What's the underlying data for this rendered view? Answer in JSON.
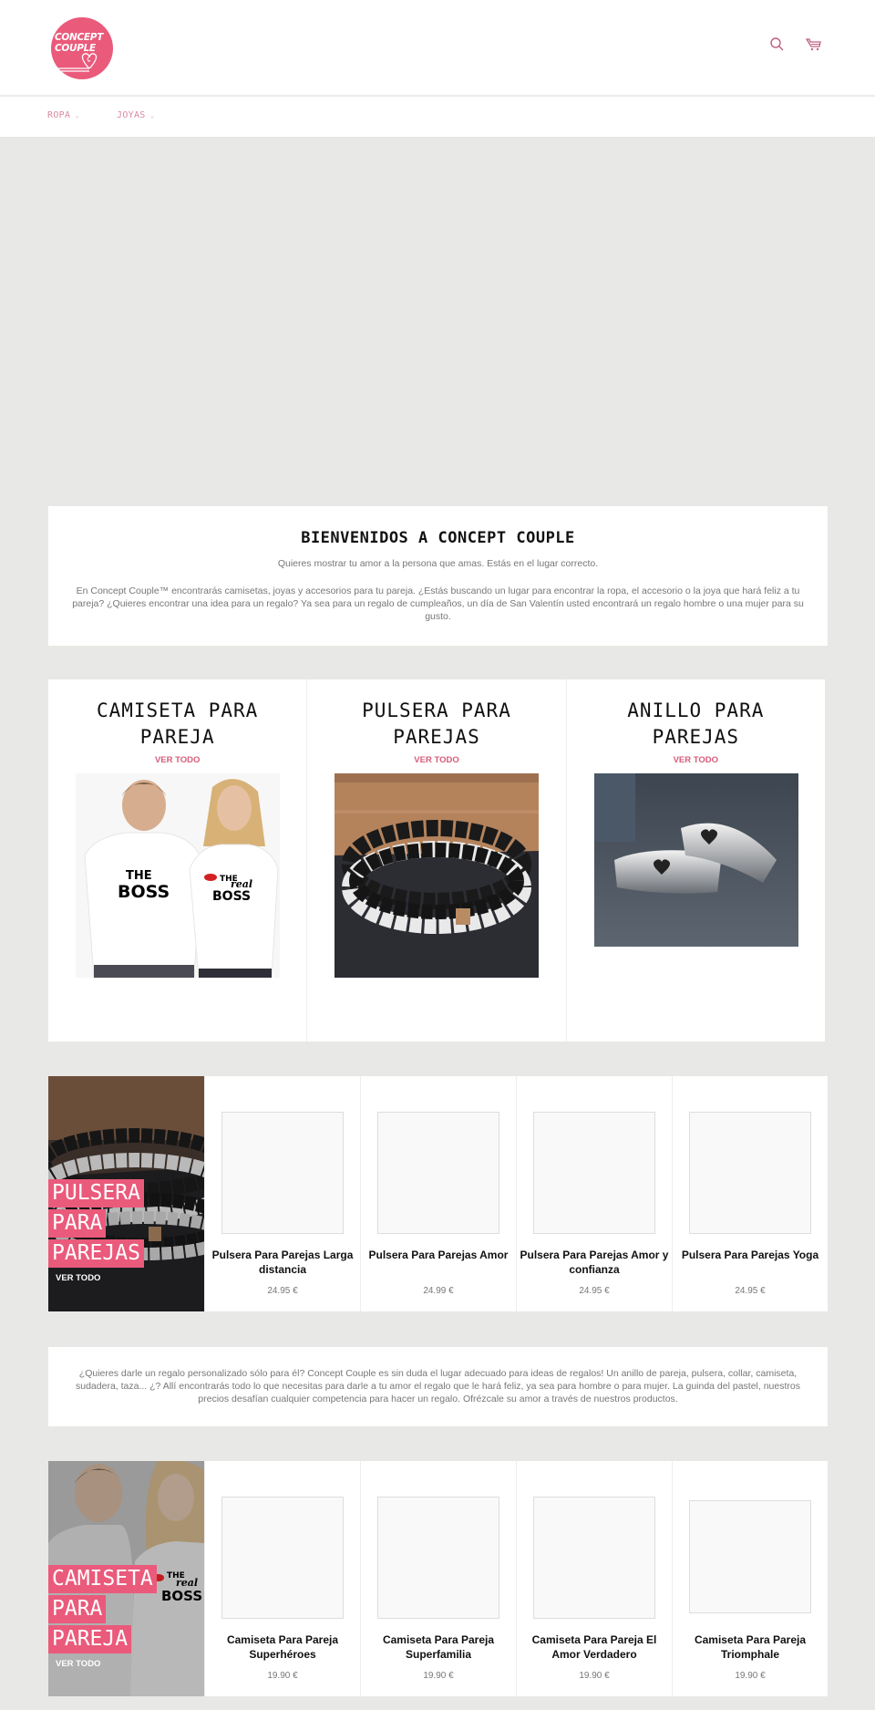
{
  "header": {
    "logo": {
      "line1": "CONCEPT",
      "line2": "COUPLE",
      "icon": "heart-logo-icon"
    },
    "icons": [
      {
        "name": "search-icon"
      },
      {
        "name": "cart-icon"
      }
    ],
    "brand_color": "#ea5a7b"
  },
  "nav": {
    "items": [
      {
        "label": "ROPA",
        "chevron": "⌄"
      },
      {
        "label": "JOYAS",
        "chevron": "⌄"
      }
    ]
  },
  "welcome": {
    "title": "BIENVENIDOS A CONCEPT COUPLE",
    "subtitle": "Quieres mostrar tu amor a la persona que amas. Estás en el lugar correcto.",
    "body": "En Concept Couple™ encontrarás camisetas, joyas y accesorios para tu pareja. ¿Estás buscando un lugar para encontrar la ropa, el accesorio o la joya que hará feliz a tu pareja? ¿Quieres encontrar una idea para un regalo? Ya sea para un regalo de cumpleaños, un día de San Valentín usted encontrará un regalo hombre o una mujer para su gusto."
  },
  "collections": [
    {
      "title": "CAMISETA PARA PAREJA",
      "link": "VER TODO",
      "image": "couple-tshirts-photo"
    },
    {
      "title": "PULSERA PARA PAREJAS",
      "link": "VER TODO",
      "image": "bead-bracelets-photo"
    },
    {
      "title": "ANILLO PARA PAREJAS",
      "link": "VER TODO",
      "image": "heart-rings-photo"
    }
  ],
  "bracelet_row": {
    "banner": {
      "lines": [
        "PULSERA",
        "PARA",
        "PAREJAS"
      ],
      "link": "VER TODO"
    },
    "products": [
      {
        "name": "Pulsera Para Parejas Larga distancia",
        "price": "24.95 €"
      },
      {
        "name": "Pulsera Para Parejas Amor",
        "price": "24.99 €"
      },
      {
        "name": "Pulsera Para Parejas Amor y confianza",
        "price": "24.95 €"
      },
      {
        "name": "Pulsera Para Parejas Yoga",
        "price": "24.95 €"
      }
    ]
  },
  "gift_text": "¿Quieres darle un regalo personalizado sólo para él? Concept Couple es sin duda el lugar adecuado para ideas de regalos! Un anillo de pareja, pulsera, collar, camiseta, sudadera, taza... ¿? Allí encontrarás todo lo que necesitas para darle a tu amor el regalo que le hará feliz, ya sea para hombre o para mujer. La guinda del pastel, nuestros precios desafían cualquier competencia para hacer un regalo. Ofrézcale su amor a través de nuestros productos.",
  "tshirt_row": {
    "banner": {
      "lines": [
        "CAMISETA",
        "PARA",
        "PAREJA"
      ],
      "link": "VER TODO"
    },
    "products": [
      {
        "name": "Camiseta Para Pareja Superhéroes",
        "price": "19.90 €"
      },
      {
        "name": "Camiseta Para Pareja Superfamilia",
        "price": "19.90 €"
      },
      {
        "name": "Camiseta Para Pareja El Amor Verdadero",
        "price": "19.90 €"
      },
      {
        "name": "Camiseta Para Pareja Triomphale",
        "price": "19.90 €"
      }
    ]
  },
  "tshirt_print": {
    "left": [
      "THE",
      "BOSS"
    ],
    "right": [
      "THE",
      "real",
      "BOSS"
    ]
  }
}
